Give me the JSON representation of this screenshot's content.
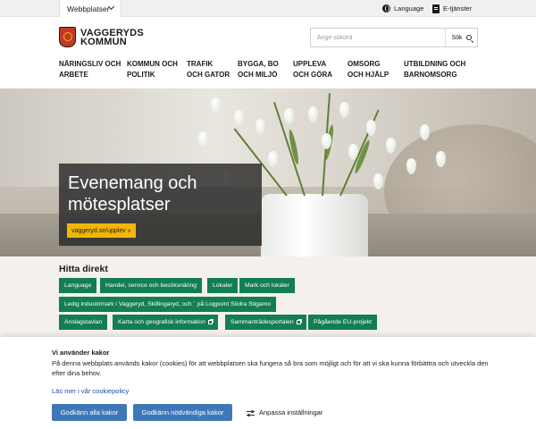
{
  "topbar": {
    "site_select_label": "Webbplatser",
    "language_label": "Language",
    "eservices_label": "E-tjänster"
  },
  "header": {
    "logo_line1": "VAGGERYDS",
    "logo_line2": "KOMMUN",
    "search_placeholder": "Ange sökord",
    "search_button_label": "Sök"
  },
  "nav": {
    "items": [
      {
        "label": "NÄRINGSLIV OCH\nARBETE"
      },
      {
        "label": "KOMMUN OCH\nPOLITIK"
      },
      {
        "label": "TRAFIK\nOCH GATOR"
      },
      {
        "label": "BYGGA, BO\nOCH MILJÖ"
      },
      {
        "label": "UPPLEVA\nOCH GÖRA"
      },
      {
        "label": "OMSORG\nOCH HJÄLP"
      },
      {
        "label": "UTBILDNING OCH\nBARNOMSORG"
      }
    ]
  },
  "hero": {
    "title": "Evenemang och mötesplatser",
    "link_label": "vaggeryd.se/upplev »"
  },
  "hitta": {
    "title": "Hitta direkt",
    "chips": [
      {
        "label": "Language"
      },
      {
        "label": "Handel, service och besöksnäring"
      },
      {
        "label": "Lokaler"
      },
      {
        "label": "Mark och lokaler"
      },
      {
        "label": "Ledig industrimark i Vaggeryd, Skillingaryd, och ` på Logpoint Södra Stigamo"
      },
      {
        "label": "Anslagstavlan"
      },
      {
        "label": "Karta och geografisk information"
      },
      {
        "label": "Sammanträdesportalen"
      },
      {
        "label": "Pågående EU-projekt"
      }
    ]
  },
  "cookie": {
    "title": "Vi använder kakor",
    "text": "På denna webbplats används kakor (cookies) för att webbplatsen ska fungera så bra som möjligt och för att vi ska kunna förbättra och utveckla den efter dina behov.",
    "policy_link": "Läs mer i vår cookiepolicy",
    "accept_all": "Godkänn alla kakor",
    "accept_necessary": "Godkänn nödvändiga kakor",
    "customize": "Anpassa inställningar"
  },
  "colors": {
    "accent_green": "#137e52",
    "accent_yellow": "#f2b705",
    "button_blue": "#3f78b8",
    "link_blue": "#1c4f9c"
  }
}
